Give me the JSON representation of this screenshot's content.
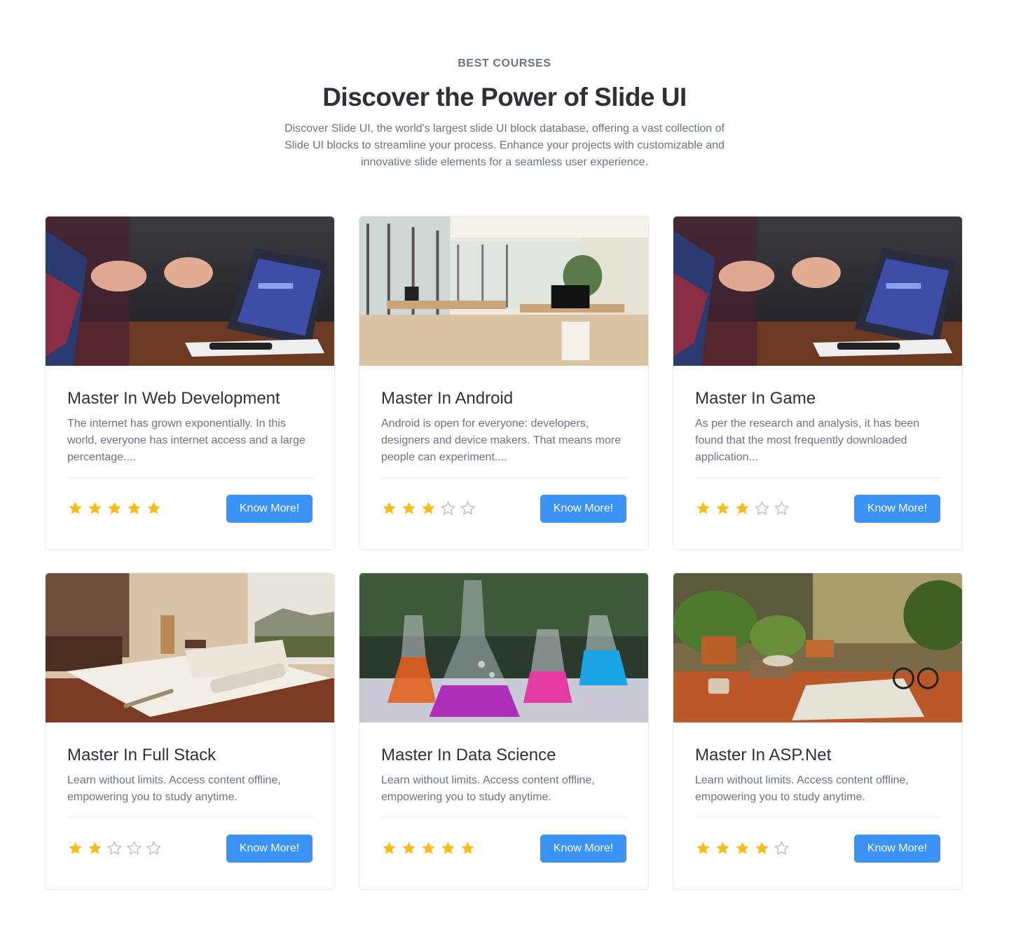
{
  "header": {
    "eyebrow": "BEST COURSES",
    "title": "Discover the Power of Slide UI",
    "description": "Discover Slide UI, the world's largest slide UI block database, offering a vast collection of Slide UI blocks to streamline your process. Enhance your projects with customizable and innovative slide elements for a seamless user experience."
  },
  "colors": {
    "accent": "#3b93f5",
    "star_filled": "#f5bd18",
    "star_empty": "#b8bdc4"
  },
  "courses": [
    {
      "title": "Master In Web Development",
      "description": "The internet has grown exponentially. In this world, everyone has internet access and a large percentage....",
      "rating": 5,
      "max_rating": 5,
      "button_label": "Know More!",
      "image": "laptop-hands-photo"
    },
    {
      "title": "Master In Android",
      "description": "Android is open for everyone: developers, designers and device makers. That means more people can experiment....",
      "rating": 3,
      "max_rating": 5,
      "button_label": "Know More!",
      "image": "office-interior-photo"
    },
    {
      "title": "Master In Game",
      "description": "As per the research and analysis, it has been found that the most frequently downloaded application...",
      "rating": 3,
      "max_rating": 5,
      "button_label": "Know More!",
      "image": "laptop-hands-photo"
    },
    {
      "title": "Master In Full Stack",
      "description": "Learn without limits. Access content offline, empowering you to study anytime.",
      "rating": 2,
      "max_rating": 5,
      "button_label": "Know More!",
      "image": "desk-notebook-photo"
    },
    {
      "title": "Master In Data Science",
      "description": "Learn without limits. Access content offline, empowering you to study anytime.",
      "rating": 5,
      "max_rating": 5,
      "button_label": "Know More!",
      "image": "lab-flasks-photo"
    },
    {
      "title": "Master In ASP.Net",
      "description": "Learn without limits. Access content offline, empowering you to study anytime.",
      "rating": 4,
      "max_rating": 5,
      "button_label": "Know More!",
      "image": "plants-desk-photo"
    }
  ]
}
